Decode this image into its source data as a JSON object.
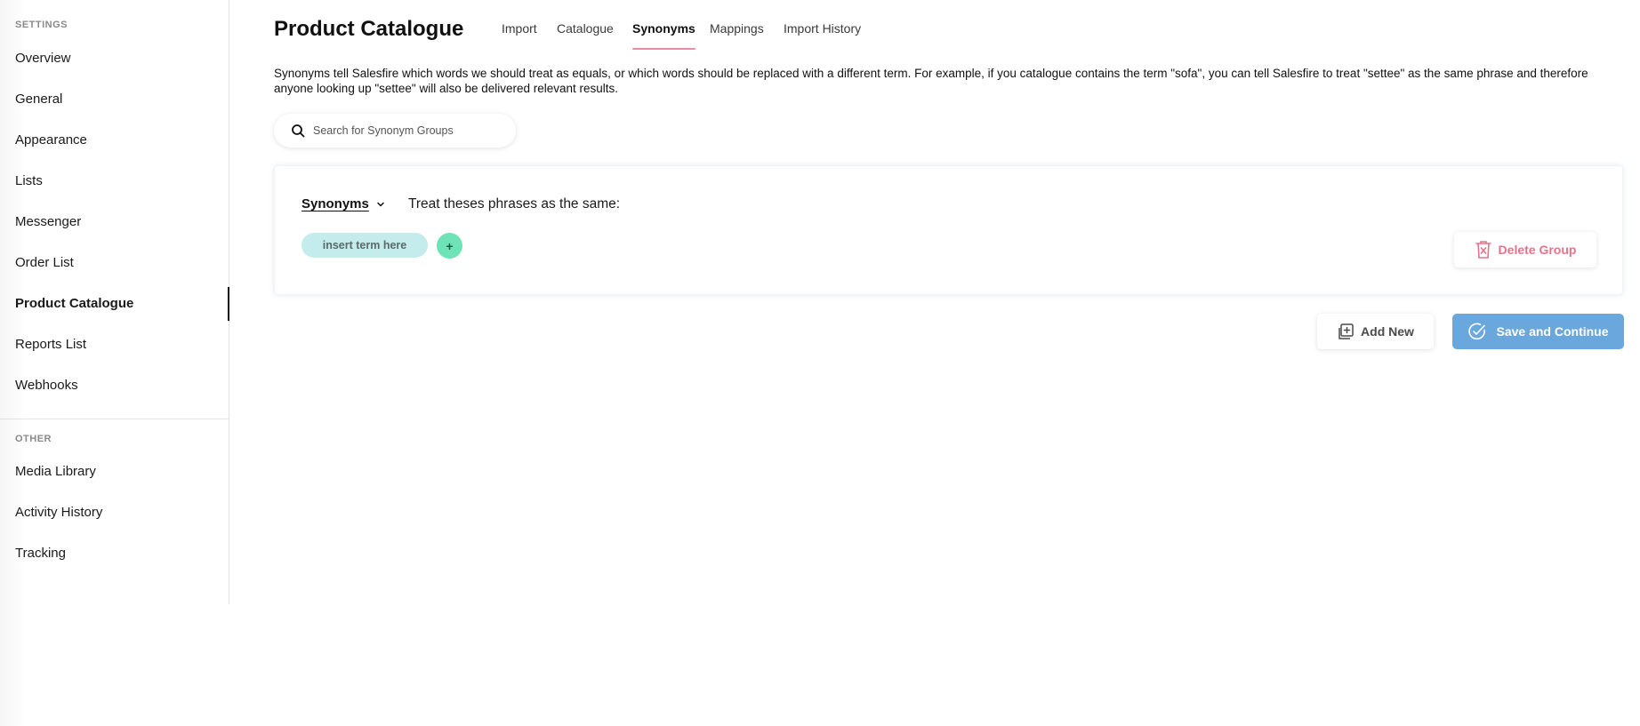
{
  "sidebar": {
    "settings_title": "SETTINGS",
    "settings_items": [
      {
        "label": "Overview"
      },
      {
        "label": "General"
      },
      {
        "label": "Appearance"
      },
      {
        "label": "Lists"
      },
      {
        "label": "Messenger"
      },
      {
        "label": "Order List"
      },
      {
        "label": "Product Catalogue",
        "active": true
      },
      {
        "label": "Reports List"
      },
      {
        "label": "Webhooks"
      }
    ],
    "other_title": "OTHER",
    "other_items": [
      {
        "label": "Media Library"
      },
      {
        "label": "Activity History"
      },
      {
        "label": "Tracking"
      }
    ]
  },
  "header": {
    "title": "Product Catalogue",
    "tabs": [
      {
        "label": "Import"
      },
      {
        "label": "Catalogue"
      },
      {
        "label": "Synonyms",
        "active": true
      },
      {
        "label": "Mappings"
      },
      {
        "label": "Import History"
      }
    ]
  },
  "description": "Synonyms tell Salesfire which words we should treat as equals, or which words should be replaced with a different term. For example, if you catalogue contains the term \"sofa\", you can tell Salesfire to treat \"settee\" as the same phrase and therefore anyone looking up \"settee\" will also be delivered relevant results.",
  "search": {
    "placeholder": "Search for Synonym Groups",
    "value": ""
  },
  "group": {
    "type_label": "Synonyms",
    "instruction": "Treat theses phrases as the same:",
    "term_placeholder": "insert term here",
    "add_term_label": "+",
    "delete_label": "Delete Group"
  },
  "actions": {
    "add_new_label": "Add New",
    "save_label": "Save and Continue"
  },
  "colors": {
    "tab_active_underline": "#e8909c",
    "chip_bg": "#c5ecec",
    "add_term_bg": "#6fe3b8",
    "delete_text": "#e6728a",
    "save_bg": "#6aa7dc"
  }
}
